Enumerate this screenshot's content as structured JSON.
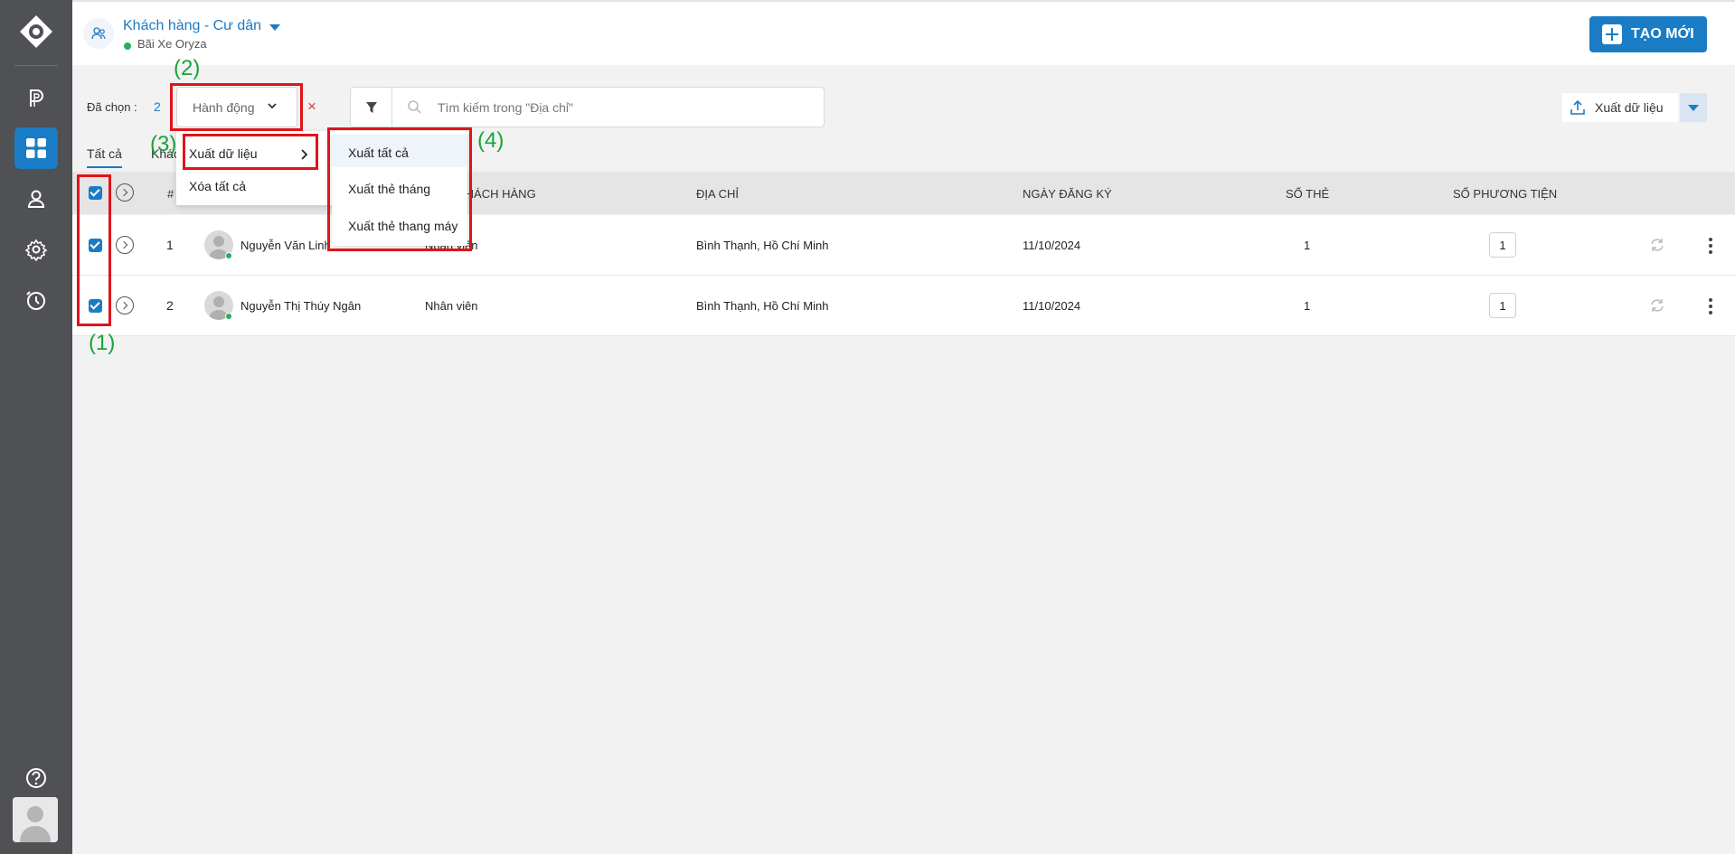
{
  "header": {
    "title": "Khách hàng - Cư dân",
    "subtitle": "Bãi Xe Oryza",
    "create_button": "TẠO MỚI"
  },
  "toolbar": {
    "selected_label": "Đã chọn :",
    "selected_count": "2",
    "action_placeholder": "Hành động",
    "clear_symbol": "×",
    "search_placeholder": "Tìm kiếm trong \"Địa chỉ\"",
    "export_label": "Xuất dữ liệu"
  },
  "tabs": [
    {
      "label": "Tất cả"
    },
    {
      "label": "Khác"
    }
  ],
  "table": {
    "columns": [
      "#",
      "KHÁCH HÀNG",
      "ĐỊA CHỈ",
      "NGÀY ĐĂNG KÝ",
      "SỐ THẺ",
      "SỐ PHƯƠNG TIỆN"
    ],
    "rows": [
      {
        "index": "1",
        "name": "Nguyễn Văn Linh",
        "type": "Nhân viên",
        "address": "Bình Thạnh, Hồ Chí Minh",
        "date": "11/10/2024",
        "cards": "1",
        "vehicles": "1"
      },
      {
        "index": "2",
        "name": "Nguyễn Thị Thúy Ngân",
        "type": "Nhân viên",
        "address": "Bình Thạnh, Hồ Chí Minh",
        "date": "11/10/2024",
        "cards": "1",
        "vehicles": "1"
      }
    ]
  },
  "action_menu": {
    "items": [
      {
        "label": "Xuất dữ liệu"
      },
      {
        "label": "Xóa tất cả"
      }
    ]
  },
  "export_submenu": {
    "items": [
      {
        "label": "Xuất tất cả"
      },
      {
        "label": "Xuất thẻ tháng"
      },
      {
        "label": "Xuất thẻ thang máy"
      }
    ]
  },
  "annotations": {
    "one": "(1)",
    "two": "(2)",
    "three": "(3)",
    "four": "(4)",
    "color": "#1aa33a",
    "box_color": "#e0141b"
  },
  "colors": {
    "accent": "#1a7cc4",
    "sidebar": "#4f5154",
    "online": "#27ae60"
  }
}
